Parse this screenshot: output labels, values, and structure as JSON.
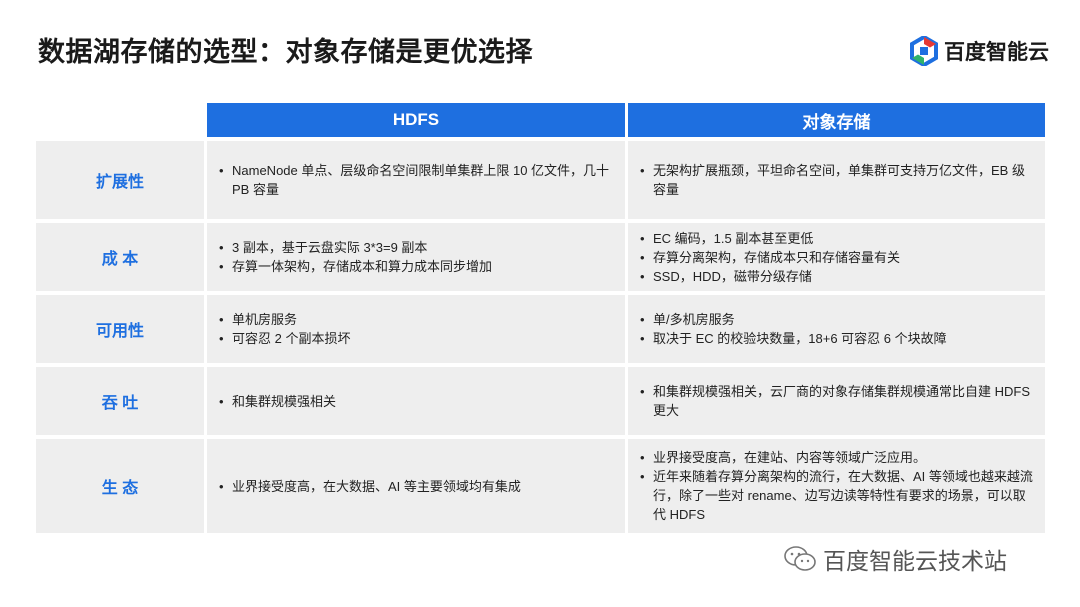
{
  "title": "数据湖存储的选型：对象存储是更优选择",
  "brand": {
    "name": "百度智能云"
  },
  "table": {
    "headers": [
      "HDFS",
      "对象存储"
    ],
    "rows": [
      {
        "label": "扩展性",
        "hdfs": [
          "NameNode 单点、层级命名空间限制单集群上限 10 亿文件，几十 PB 容量"
        ],
        "object": [
          "无架构扩展瓶颈，平坦命名空间，单集群可支持万亿文件，EB 级容量"
        ]
      },
      {
        "label": "成 本",
        "hdfs": [
          "3 副本，基于云盘实际 3*3=9 副本",
          "存算一体架构，存储成本和算力成本同步增加"
        ],
        "object": [
          "EC 编码，1.5 副本甚至更低",
          "存算分离架构，存储成本只和存储容量有关",
          "SSD，HDD，磁带分级存储"
        ]
      },
      {
        "label": "可用性",
        "hdfs": [
          "单机房服务",
          "可容忍 2 个副本损坏"
        ],
        "object": [
          "单/多机房服务",
          "取决于 EC 的校验块数量，18+6 可容忍 6 个块故障"
        ]
      },
      {
        "label": "吞 吐",
        "hdfs": [
          "和集群规模强相关"
        ],
        "object": [
          "和集群规模强相关，云厂商的对象存储集群规模通常比自建 HDFS 更大"
        ]
      },
      {
        "label": "生 态",
        "hdfs": [
          "业界接受度高，在大数据、AI 等主要领域均有集成"
        ],
        "object": [
          "业界接受度高，在建站、内容等领域广泛应用。",
          "近年来随着存算分离架构的流行，在大数据、AI 等领域也越来越流行，除了一些对 rename、边写边读等特性有要求的场景，可以取代 HDFS"
        ]
      }
    ]
  },
  "watermark": {
    "text": "百度智能云技术站"
  },
  "colors": {
    "accent": "#1e6fe0",
    "cell_bg": "#eeeeee"
  }
}
